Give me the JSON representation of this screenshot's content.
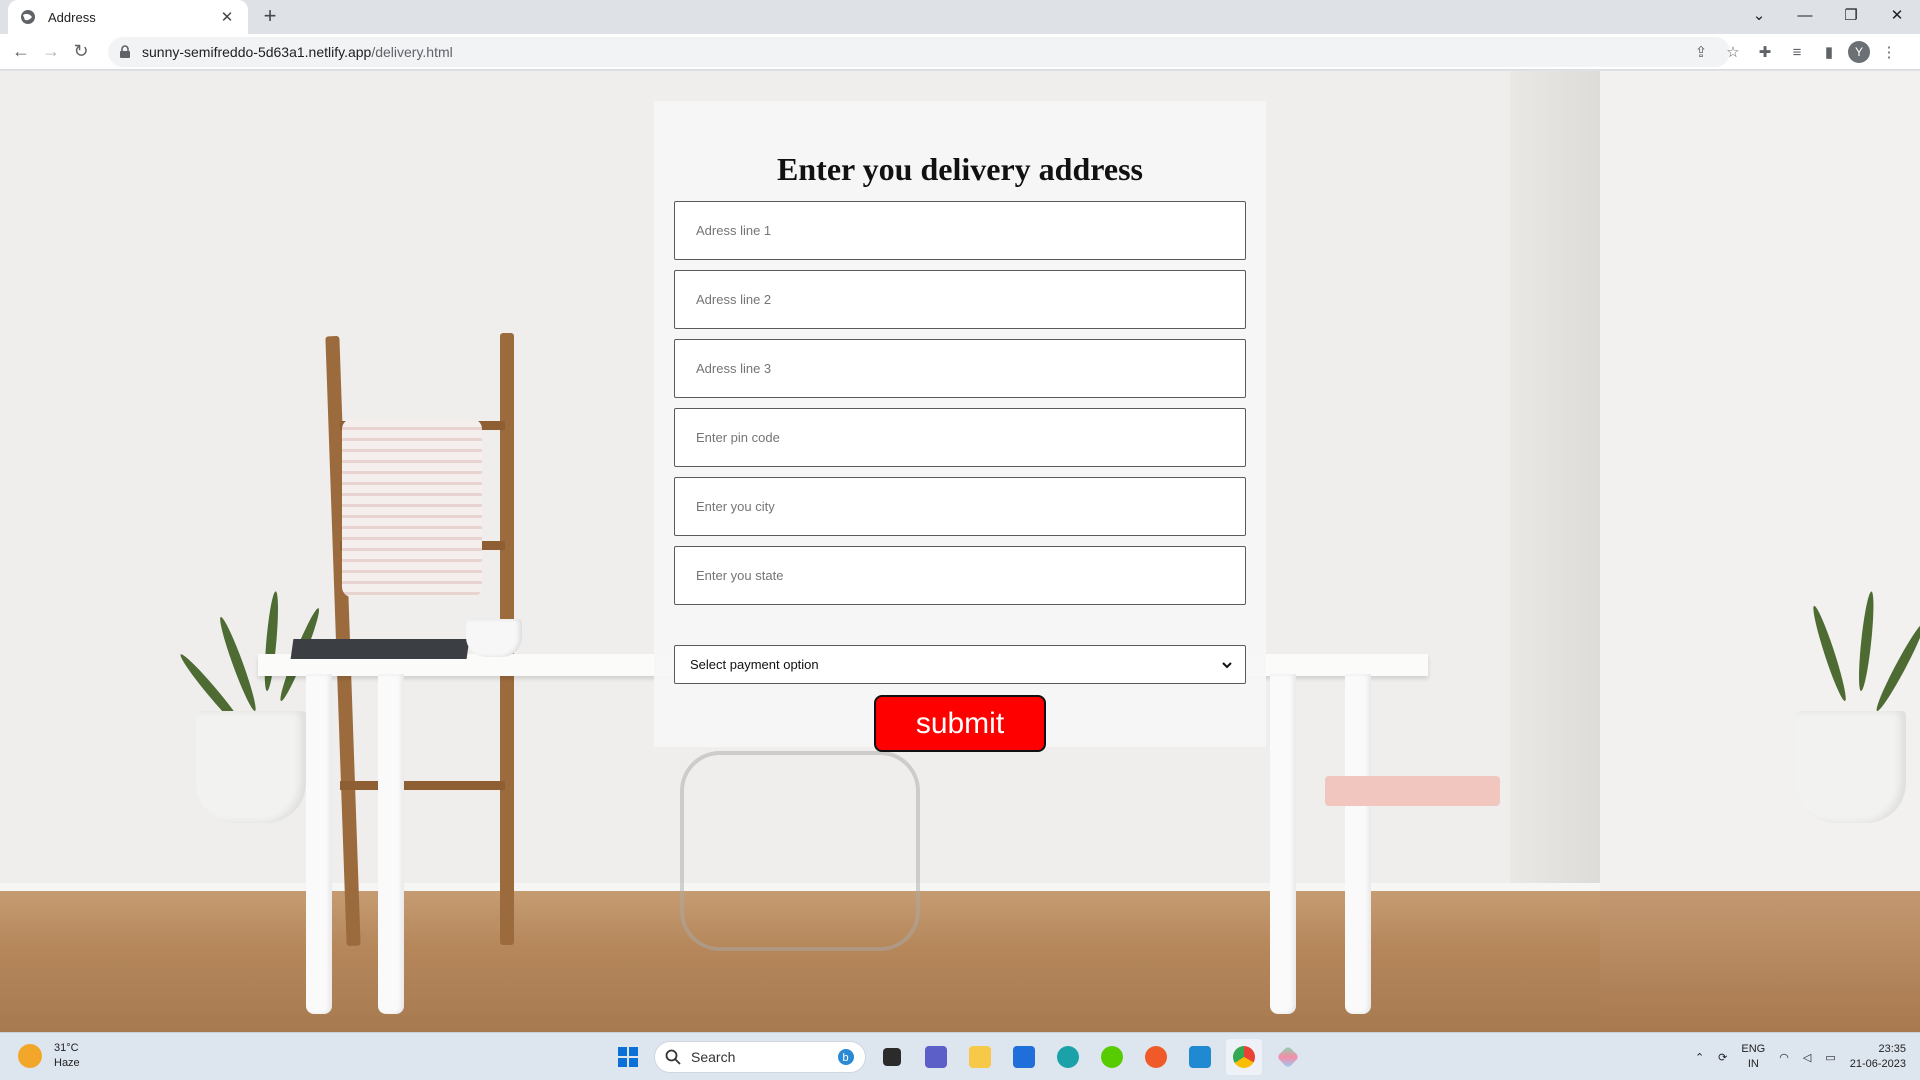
{
  "browser": {
    "tab_title": "Address",
    "tab_close": "✕",
    "new_tab": "+",
    "url_host": "sunny-semifreddo-5d63a1.netlify.app",
    "url_path": "/delivery.html",
    "profile_initial": "Y"
  },
  "form": {
    "title": "Enter you delivery address",
    "fields": [
      {
        "placeholder": "Adress line 1"
      },
      {
        "placeholder": "Adress line 2"
      },
      {
        "placeholder": "Adress line 3"
      },
      {
        "placeholder": "Enter pin code"
      },
      {
        "placeholder": "Enter you city"
      },
      {
        "placeholder": "Enter you state"
      }
    ],
    "payment_select": "Select payment option",
    "submit_label": "submit",
    "submit_color": "#ff0000"
  },
  "taskbar": {
    "weather_temp": "31°C",
    "weather_desc": "Haze",
    "search_label": "Search",
    "lang_line1": "ENG",
    "lang_line2": "IN",
    "time": "23:35",
    "date": "21-06-2023"
  }
}
